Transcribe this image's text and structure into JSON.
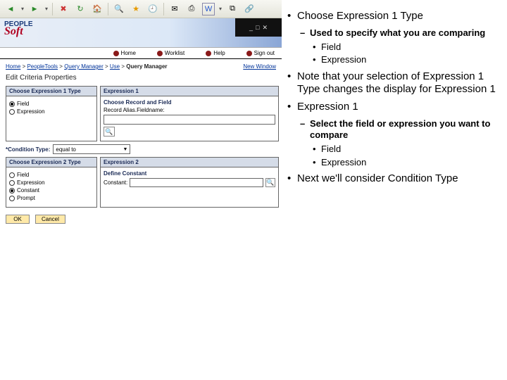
{
  "toolbar": {
    "back": "◄",
    "fwd": "►",
    "stop": "✖",
    "refresh": "↻",
    "home": "🏠",
    "search": "🔍",
    "fav": "★",
    "history": "🕘",
    "mail": "✉",
    "print": "⎙",
    "word": "W",
    "ext1": "⧉",
    "ext2": "🔗"
  },
  "logo": {
    "line1": "PEOPLE",
    "line2": "Soft"
  },
  "winctl": {
    "min": "_",
    "max": "□",
    "close": "✕"
  },
  "nav": {
    "home": "Home",
    "worklist": "Worklist",
    "help": "Help",
    "signout": "Sign out"
  },
  "breadcrumbs": {
    "parts": [
      "Home",
      "PeopleTools",
      "Query Manager",
      "Use"
    ],
    "current": "Query Manager",
    "new_window": "New Window"
  },
  "page_title": "Edit Criteria Properties",
  "expr1": {
    "left_title": "Choose Expression 1 Type",
    "right_title": "Expression 1",
    "subhead": "Choose Record and Field",
    "fieldlabel": "Record Alias.Fieldname:",
    "field_radio": "Field",
    "expr_radio": "Expression"
  },
  "cond": {
    "label": "*Condition Type:",
    "value": "equal to"
  },
  "expr2": {
    "left_title": "Choose Expression 2 Type",
    "right_title": "Expression 2",
    "subhead": "Define Constant",
    "const_label": "Constant:",
    "r_field": "Field",
    "r_expr": "Expression",
    "r_const": "Constant",
    "r_prompt": "Prompt"
  },
  "buttons": {
    "ok": "OK",
    "cancel": "Cancel"
  },
  "notes": {
    "t1": "Choose Expression 1 Type",
    "t1a": "Used to specify what you are comparing",
    "t1a1": "Field",
    "t1a2": "Expression",
    "t2": "Note that your selection of Expression 1 Type changes the display for Expression 1",
    "t3": "Expression 1",
    "t3a": "Select the field or expression you want to compare",
    "t3a1": "Field",
    "t3a2": "Expression",
    "t4": "Next we'll consider Condition Type"
  }
}
